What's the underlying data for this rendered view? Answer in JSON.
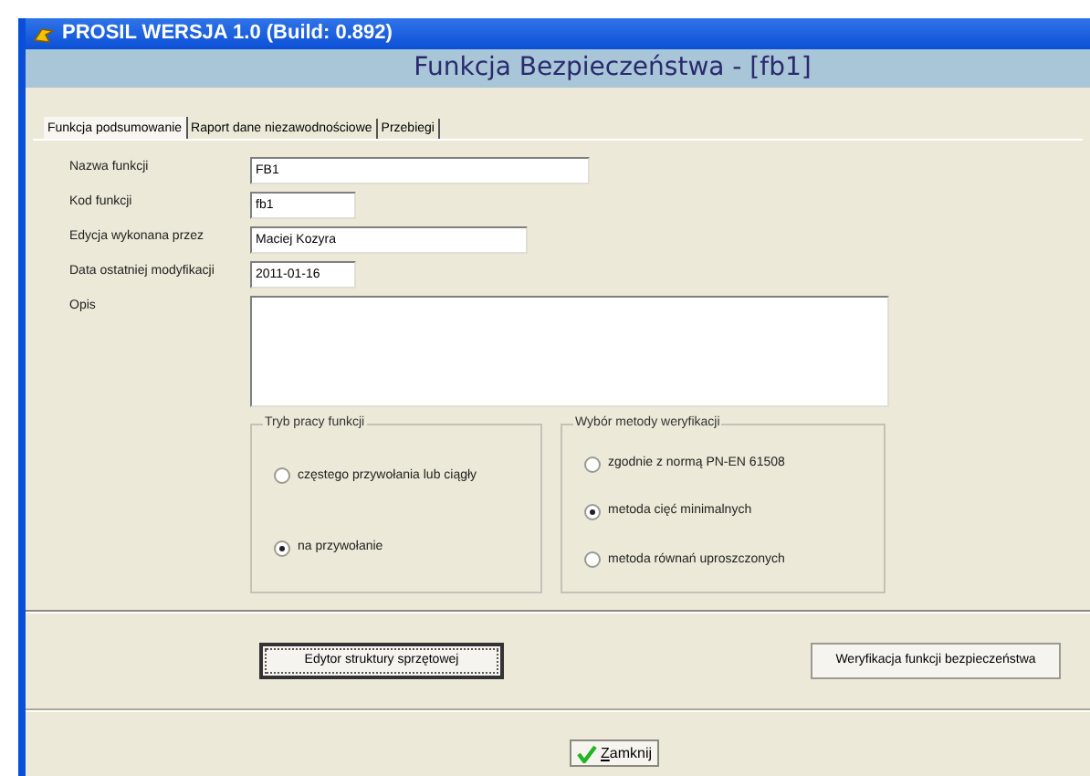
{
  "window": {
    "title": "PROSIL WERSJA 1.0 (Build: 0.892)"
  },
  "header": "Funkcja Bezpieczeństwa - [fb1]",
  "tabs": [
    {
      "label": "Funkcja podsumowanie",
      "selected": true
    },
    {
      "label": "Raport dane niezawodnościowe",
      "selected": false
    },
    {
      "label": "Przebiegi",
      "selected": false
    }
  ],
  "fields": [
    {
      "label": "Nazwa funkcji",
      "value": "FB1",
      "kind": "line"
    },
    {
      "label": "Kod funkcji",
      "value": "fb1",
      "kind": "line"
    },
    {
      "label": "Edycja wykonana przez",
      "value": "Maciej Kozyra",
      "kind": "line"
    },
    {
      "label": "Data ostatniej modyfikacji",
      "value": "2011-01-16",
      "kind": "line"
    },
    {
      "label": "Opis",
      "kind": "area"
    }
  ],
  "groups": [
    {
      "title": "Tryb pracy funkcji",
      "options": [
        {
          "label": "częstego przywołania lub ciągły",
          "selected": false
        },
        {
          "label": "na przywołanie",
          "selected": true
        }
      ]
    },
    {
      "title": "Wybór metody weryfikacji",
      "options": [
        {
          "label": "zgodnie z normą PN-EN 61508",
          "selected": false
        },
        {
          "label": "metoda cięć minimalnych",
          "selected": true
        },
        {
          "label": "metoda równań uproszczonych",
          "selected": false
        }
      ]
    }
  ],
  "buttons": [
    {
      "label": "Edytor struktury sprzętowej",
      "focused": true
    },
    {
      "label": "Weryfikacja funkcji bezpieczeństwa",
      "focused": false
    }
  ],
  "close_button": "Zamknij"
}
